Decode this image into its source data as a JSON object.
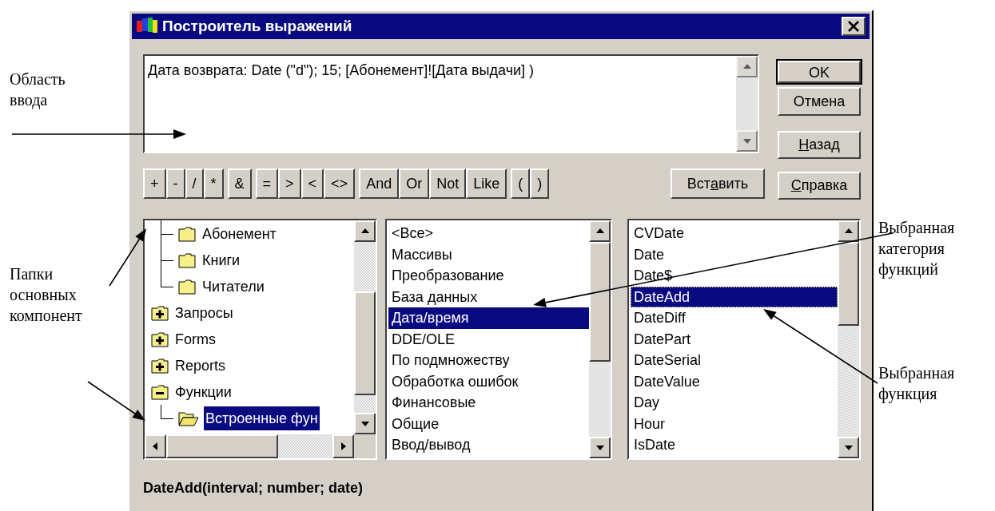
{
  "annotations_left": [
    {
      "lines": [
        "Область",
        "ввода"
      ]
    },
    {
      "lines": [
        "Папки",
        "основных",
        "компонент"
      ]
    }
  ],
  "annotations_right": [
    {
      "lines": [
        "Выбранная",
        "категория",
        "функций"
      ]
    },
    {
      "lines": [
        "Выбранная",
        "функция"
      ]
    }
  ],
  "window": {
    "title": "Построитель выражений"
  },
  "expression": {
    "value": "Дата возврата: Date (\"d\"); 15; [Абонемент]![Дата выдачи] )"
  },
  "side_buttons": [
    {
      "after": "OK",
      "default": true
    },
    {
      "after": "Отмена",
      "default": false
    },
    {
      "key": "Н",
      "after": "азад",
      "default": false
    },
    {
      "key": "С",
      "after": "правка",
      "default": false
    }
  ],
  "operator_groups": [
    [
      "+",
      "-",
      "/",
      "*"
    ],
    [
      "&"
    ],
    [
      "=",
      ">",
      "<",
      "<>"
    ],
    [
      "And",
      "Or",
      "Not",
      "Like"
    ],
    [
      "(",
      ")"
    ]
  ],
  "insert_button": {
    "before": "Вст",
    "key": "а",
    "after": "вить"
  },
  "tree": [
    {
      "children": [
        {
          "label": "Абонемент",
          "kind": "folder",
          "selected": false
        },
        {
          "label": "Книги",
          "kind": "folder",
          "selected": false
        },
        {
          "label": "Читатели",
          "kind": "folder",
          "selected": false
        }
      ]
    },
    {
      "label": "Запросы",
      "kind": "group",
      "expanded": false,
      "selected": false
    },
    {
      "label": "Forms",
      "kind": "group",
      "expanded": false,
      "selected": false
    },
    {
      "label": "Reports",
      "kind": "group",
      "expanded": false,
      "selected": false
    },
    {
      "label": "Функции",
      "kind": "group",
      "expanded": true,
      "selected": false,
      "children": [
        {
          "label": "Встроенные фун",
          "kind": "open-folder",
          "selected": true
        }
      ]
    }
  ],
  "categories": [
    {
      "label": "<Все>",
      "selected": false
    },
    {
      "label": "Массивы",
      "selected": false
    },
    {
      "label": "Преобразование",
      "selected": false
    },
    {
      "label": "База данных",
      "selected": false
    },
    {
      "label": "Дата/время",
      "selected": true
    },
    {
      "label": "DDE/OLE",
      "selected": false
    },
    {
      "label": "По подмножеству",
      "selected": false
    },
    {
      "label": "Обработка ошибок",
      "selected": false
    },
    {
      "label": "Финансовые",
      "selected": false
    },
    {
      "label": "Общие",
      "selected": false
    },
    {
      "label": "Ввод/вывод",
      "selected": false
    }
  ],
  "functions": [
    {
      "label": "CVDate",
      "selected": false
    },
    {
      "label": "Date",
      "selected": false
    },
    {
      "label": "Date$",
      "selected": false
    },
    {
      "label": "DateAdd",
      "selected": true
    },
    {
      "label": "DateDiff",
      "selected": false
    },
    {
      "label": "DatePart",
      "selected": false
    },
    {
      "label": "DateSerial",
      "selected": false
    },
    {
      "label": "DateValue",
      "selected": false
    },
    {
      "label": "Day",
      "selected": false
    },
    {
      "label": "Hour",
      "selected": false
    },
    {
      "label": "IsDate",
      "selected": false
    }
  ],
  "status": "DateAdd(interval; number; date)"
}
